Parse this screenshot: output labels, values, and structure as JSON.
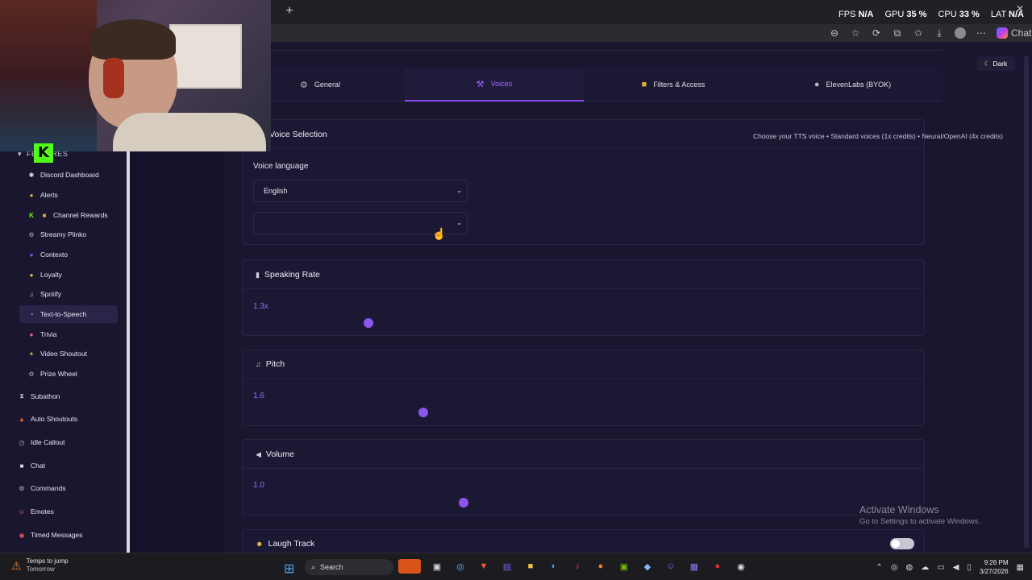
{
  "browser": {
    "new_tab_icon": "plus-icon",
    "overlay_stats": {
      "fps_label": "FPS",
      "fps_value": "N/A",
      "gpu_label": "GPU",
      "gpu_value": "35 %",
      "cpu_label": "CPU",
      "cpu_value": "33 %",
      "lat_label": "LAT",
      "lat_value": "N/A"
    },
    "chat_label": "Chat"
  },
  "sidebar": {
    "section_label": "FEATURES",
    "items": [
      {
        "label": "Discord Dashboard",
        "icon": "✱"
      },
      {
        "label": "Alerts",
        "icon": "🔔"
      },
      {
        "label": "Channel Rewards",
        "icon": "🎁"
      },
      {
        "label": "Streamy Plinko",
        "icon": "⚙"
      },
      {
        "label": "Contexto",
        "icon": "●"
      },
      {
        "label": "Loyalty",
        "icon": "●"
      },
      {
        "label": "Spotify",
        "icon": "♫"
      },
      {
        "label": "Text-to-Speech",
        "icon": "🗣"
      },
      {
        "label": "Trivia",
        "icon": "●"
      },
      {
        "label": "Video Shoutout",
        "icon": "✦"
      },
      {
        "label": "Prize Wheel",
        "icon": "⚙"
      }
    ],
    "top_items": [
      {
        "label": "Subathon",
        "icon": "⧗"
      },
      {
        "label": "Auto Shoutouts",
        "icon": "🔥"
      },
      {
        "label": "Idle Callout",
        "icon": "⏲"
      },
      {
        "label": "Chat",
        "icon": "💬"
      },
      {
        "label": "Commands",
        "icon": "⚙"
      },
      {
        "label": "Emotes",
        "icon": "☺"
      },
      {
        "label": "Timed Messages",
        "icon": "⏰"
      }
    ]
  },
  "header": {
    "theme_button": "Dark"
  },
  "tabs": [
    {
      "label": "General",
      "icon": "gear-icon"
    },
    {
      "label": "Voices",
      "icon": "wand-icon"
    },
    {
      "label": "Filters & Access",
      "icon": "lock-icon"
    },
    {
      "label": "ElevenLabs (BYOK)",
      "icon": "microphone-icon"
    }
  ],
  "voice_selection": {
    "title": "Voice Selection",
    "hint": "Choose your TTS voice • Standard voices (1x credits) • Neural/OpenAI (4x credits)",
    "language_label": "Voice language",
    "language_value": "English",
    "voice_value": ""
  },
  "speaking_rate": {
    "title": "Speaking Rate",
    "value": "1.3x",
    "level": 0.3
  },
  "pitch": {
    "title": "Pitch",
    "value": "1.6",
    "level": 0.6
  },
  "volume": {
    "title": "Volume",
    "value": "1.0",
    "level": 1.0
  },
  "laugh_track": {
    "title": "Laugh Track",
    "enabled": false
  },
  "watermark": {
    "line1": "Activate Windows",
    "line2": "Go to Settings to activate Windows."
  },
  "taskbar": {
    "weather_title": "Temps to jump",
    "weather_sub": "Tomorrow",
    "search_label": "Search",
    "time": "9:26 PM",
    "date": "3/27/2026"
  },
  "colors": {
    "accent": "#8b55ee",
    "background": "#14112a",
    "card": "#1b1833"
  }
}
